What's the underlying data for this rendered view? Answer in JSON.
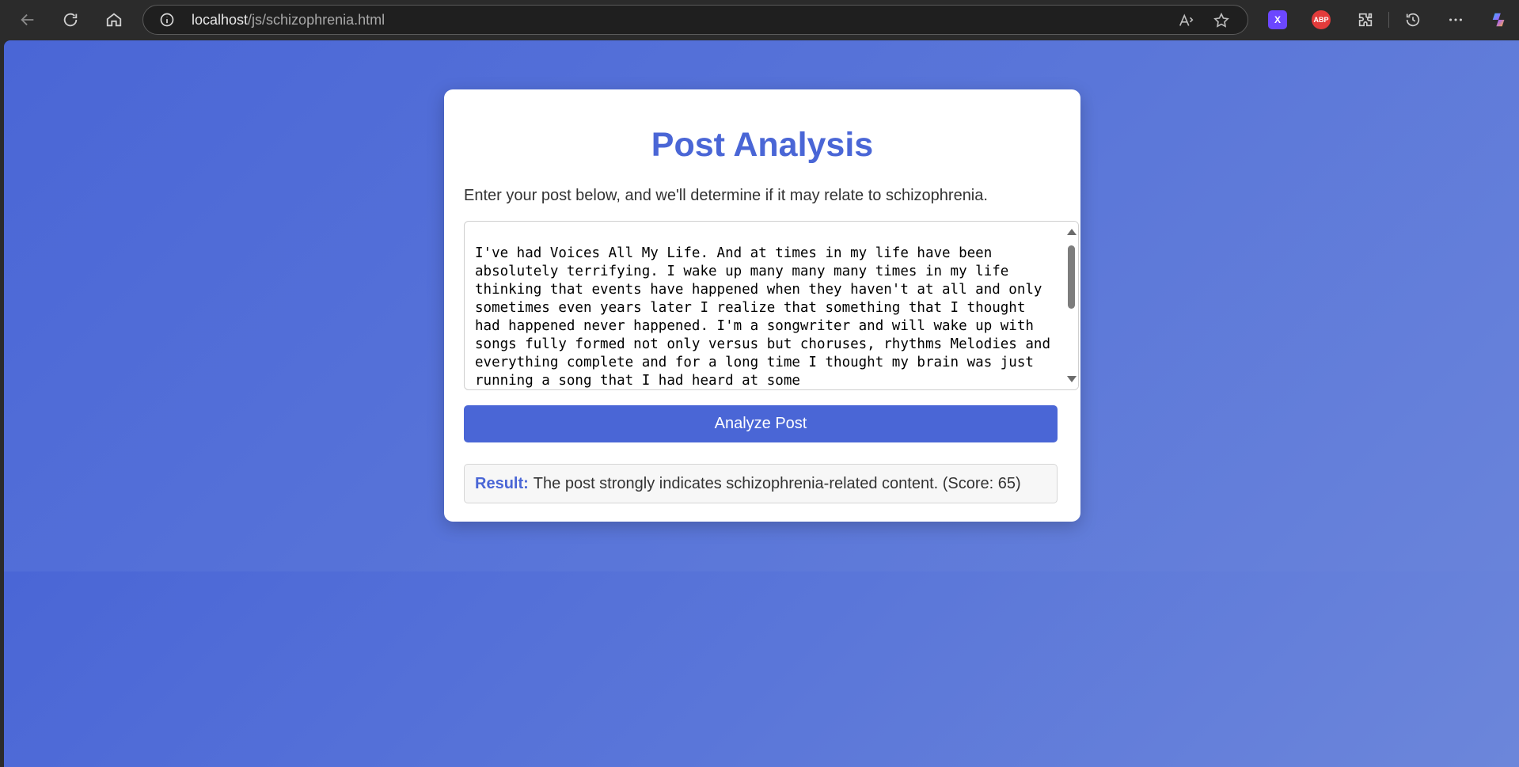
{
  "browser": {
    "url_host": "localhost",
    "url_path": "/js/schizophrenia.html",
    "icons": {
      "back": "back-arrow-icon",
      "refresh": "refresh-icon",
      "home": "home-icon",
      "info": "info-icon",
      "read_aloud": "read-aloud-icon",
      "favorite": "star-icon",
      "extensions": "puzzle-icon",
      "history": "history-icon",
      "more": "more-icon",
      "copilot": "copilot-icon"
    },
    "extensions": [
      {
        "label": "X",
        "color": "#6c47ff"
      },
      {
        "label": "ABP",
        "color": "#e23b3b"
      }
    ]
  },
  "page": {
    "title": "Post Analysis",
    "subtitle": "Enter your post below, and we'll determine if it may relate to schizophrenia.",
    "post_text": "I've had Voices All My Life. And at times in my life have been absolutely terrifying. I wake up many many many times in my life thinking that events have happened when they haven't at all and only sometimes even years later I realize that something that I thought had happened never happened. I'm a songwriter and will wake up with songs fully formed not only versus but choruses, rhythms Melodies and everything complete and for a long time I thought my brain was just running a song that I had heard at some",
    "analyze_button": "Analyze Post",
    "result_label": "Result:",
    "result_text": "The post strongly indicates schizophrenia-related content. (Score: 65)"
  },
  "colors": {
    "accent": "#4a66d6",
    "background_gradient_start": "#4a66d6",
    "background_gradient_end": "#6c86da"
  }
}
